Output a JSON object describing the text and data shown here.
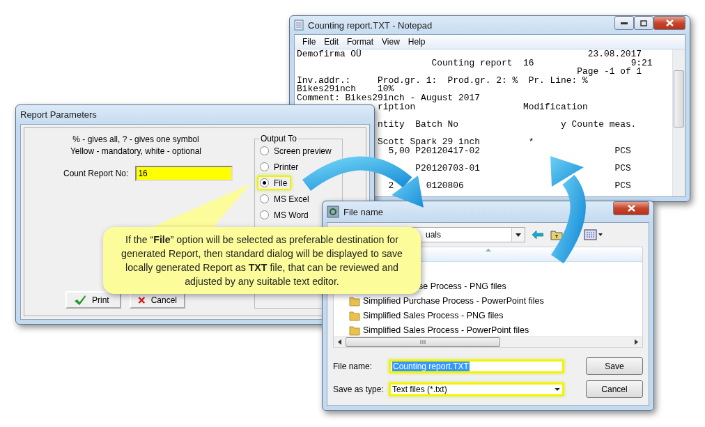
{
  "notepad": {
    "title": "Counting report.TXT - Notepad",
    "menu": [
      "File",
      "Edit",
      "Format",
      "View",
      "Help"
    ],
    "paragraphs": [
      [
        "Demofirma OÜ                                          23.08.2017",
        "                         Counting report  16                  9:21",
        "                                                    Page -1 of 1",
        "Inv.addr.:     Prod.gr. 1:  Prod.gr. 2: %  Pr. Line: %",
        "Bikes29inch    10%",
        "Comment: Bikes29inch - August 2017",
        "               ription                    Modification"
      ],
      [
        "               ntity  Batch No                   y Counte meas."
      ],
      [
        "               Scott Spark 29 inch         *",
        "                 5,00 P20120417-02                         PCS"
      ],
      [
        "                      P20120703-01                         PCS"
      ],
      [
        "                 2      0120806                            PCS"
      ]
    ]
  },
  "report_parameters": {
    "title": "Report Parameters",
    "hints": [
      "% - gives all, ? - gives one symbol",
      "Yellow - mandatory, white - optional"
    ],
    "count_report": {
      "label": "Count Report No:",
      "value": "16"
    },
    "output_to": {
      "label": "Output To",
      "options": [
        {
          "label": "Screen preview",
          "selected": false,
          "highlighted": false
        },
        {
          "label": "Printer",
          "selected": false,
          "highlighted": false
        },
        {
          "label": "File",
          "selected": true,
          "highlighted": true
        },
        {
          "label": "MS Excel",
          "selected": false,
          "highlighted": false
        },
        {
          "label": "MS Word",
          "selected": false,
          "highlighted": false
        }
      ]
    },
    "buttons": [
      {
        "label": "Print",
        "kind": "ok"
      },
      {
        "label": "Cancel",
        "kind": "cancel"
      }
    ]
  },
  "file_dialog": {
    "title": "File name",
    "location": "uals",
    "items": [
      {
        "text": "se Process - PNG files",
        "clipped": true
      },
      {
        "text": "Simplified Purchase Process - PowerPoint files",
        "clipped": false
      },
      {
        "text": "Simplified Sales Process - PNG files",
        "clipped": false
      },
      {
        "text": "Simplified Sales Process - PowerPoint files",
        "clipped": false
      }
    ],
    "file_name": {
      "label": "File name:",
      "value": "Counting report.TXT",
      "highlighted": true
    },
    "save_as_type": {
      "label": "Save as type:",
      "value": "Text files (*.txt)",
      "highlighted": true
    },
    "buttons": [
      "Save",
      "Cancel"
    ]
  },
  "callout": "If the “**File**” option will be selected as preferable destination for generated Report, then standard dialog will be displayed to save locally generated Report as **TXT** file, that can be reviewed and adjusted by any suitable text editor."
}
